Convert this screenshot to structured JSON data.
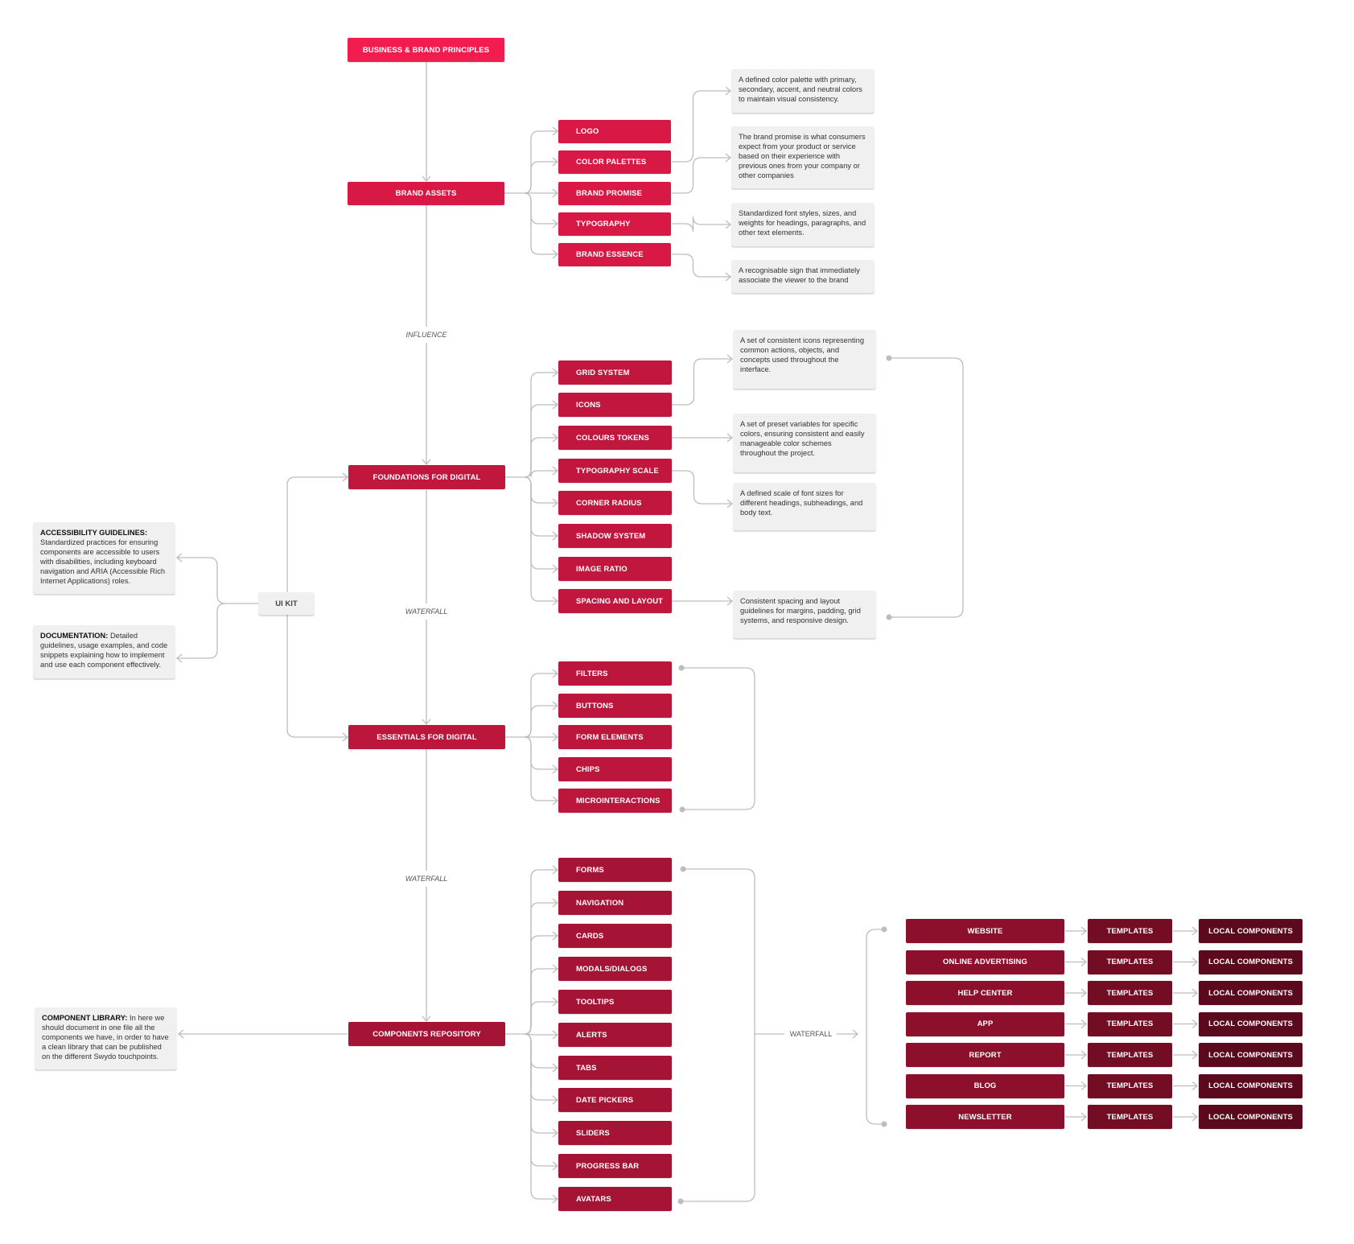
{
  "diagram": {
    "root": "BUSINESS & BRAND PRINCIPLES",
    "edge_labels": {
      "influence": "INFLUENCE",
      "waterfall_1": "WATERFALL",
      "waterfall_2": "WATERFALL",
      "waterfall_3": "WATERFALL"
    },
    "brand_assets": {
      "label": "BRAND ASSETS",
      "children": [
        "LOGO",
        "COLOR PALETTES",
        "BRAND PROMISE",
        "TYPOGRAPHY",
        "BRAND ESSENCE"
      ],
      "notes": [
        "A defined color palette with primary, secondary, accent, and neutral colors to maintain visual consistency.",
        "The brand promise is what consumers expect from your product or service based on their experience with previous ones from your company or other companies",
        "Standardized font styles, sizes, and weights for headings, paragraphs, and other text elements.",
        "A recognisable sign that immediately associate the viewer to the brand"
      ]
    },
    "foundations": {
      "label": "FOUNDATIONS FOR DIGITAL",
      "children": [
        "GRID SYSTEM",
        "ICONS",
        "COLOURS TOKENS",
        "TYPOGRAPHY SCALE",
        "CORNER RADIUS",
        "SHADOW SYSTEM",
        "IMAGE RATIO",
        "SPACING AND LAYOUT"
      ],
      "notes": [
        "A set of consistent icons representing common actions, objects, and concepts used throughout the interface.",
        "A set of preset variables for specific colors, ensuring consistent and easily manageable color schemes throughout the project.",
        "A defined scale of font sizes for different headings, subheadings, and body text.",
        "Consistent spacing and layout guidelines for margins, padding, grid systems, and responsive design."
      ]
    },
    "ui_kit": {
      "label": "UI KIT",
      "notes": [
        {
          "title": "ACCESSIBILITY GUIDELINES:",
          "body": "Standardized practices for ensuring components are accessible to users with disabilities, including keyboard navigation and ARIA (Accessible Rich Internet Applications) roles."
        },
        {
          "title": "DOCUMENTATION:",
          "body": "Detailed guidelines, usage examples, and code snippets explaining how to implement and use each component effectively."
        }
      ]
    },
    "essentials": {
      "label": "ESSENTIALS FOR DIGITAL",
      "children": [
        "FILTERS",
        "BUTTONS",
        "FORM ELEMENTS",
        "CHIPS",
        "MICROINTERACTIONS"
      ]
    },
    "components": {
      "label": "COMPONENTS REPOSITORY",
      "children": [
        "FORMS",
        "NAVIGATION",
        "CARDS",
        "MODALS/DIALOGS",
        "TOOLTIPS",
        "ALERTS",
        "TABS",
        "DATE PICKERS",
        "SLIDERS",
        "PROGRESS BAR",
        "AVATARS"
      ],
      "library_note": {
        "title": "COMPONENT LIBRARY:",
        "body": "In here we should document in one file all the components we have, in order to have a clean library that can be published on the different Swydo touchpoints."
      }
    },
    "channels": {
      "items": [
        "WEBSITE",
        "ONLINE ADVERTISING",
        "HELP CENTER",
        "APP",
        "REPORT",
        "BLOG",
        "NEWSLETTER"
      ],
      "templates_label": "TEMPLATES",
      "local_label": "LOCAL COMPONENTS"
    }
  },
  "colors": {
    "root": "#f31c4f",
    "brand": "#d81946",
    "foundations": "#c1173f",
    "essentials": "#bc163d",
    "components": "#a51335",
    "channels": "#8c102c",
    "templates": "#730d24",
    "local": "#5a0a1c",
    "note_bg": "#f0f0f0",
    "connector": "#bdbdbd"
  }
}
